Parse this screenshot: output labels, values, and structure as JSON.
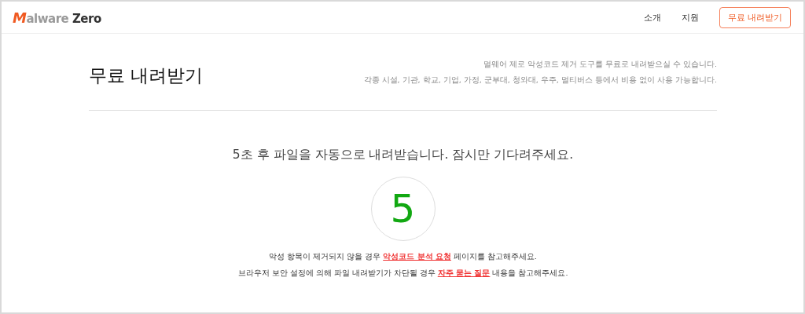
{
  "header": {
    "logo": {
      "initial": "M",
      "rest": "alware",
      "second": "Zero"
    },
    "nav": [
      "소개",
      "지원"
    ],
    "download_button": "무료 내려받기"
  },
  "page": {
    "title": "무료 내려받기",
    "description": [
      "멀웨어 제로 악성코드 제거 도구를 무료로 내려받으실 수 있습니다.",
      "각종 시설, 기관, 학교, 기업, 가정, 군부대, 청와대, 우주, 멀티버스 등에서 비용 없이 사용 가능합니다."
    ]
  },
  "countdown": {
    "message": "5초 후 파일을 자동으로 내려받습니다. 잠시만 기다려주세요.",
    "seconds": "5"
  },
  "notices": [
    {
      "before": "악성 항목이 제거되지 않을 경우 ",
      "link": "악성코드 분석 요청",
      "after": " 페이지를 참고해주세요."
    },
    {
      "before": "브라우저 보안 설정에 의해 파일 내려받기가 차단될 경우 ",
      "link": "자주 묻는 질문",
      "after": " 내용을 참고해주세요."
    }
  ]
}
